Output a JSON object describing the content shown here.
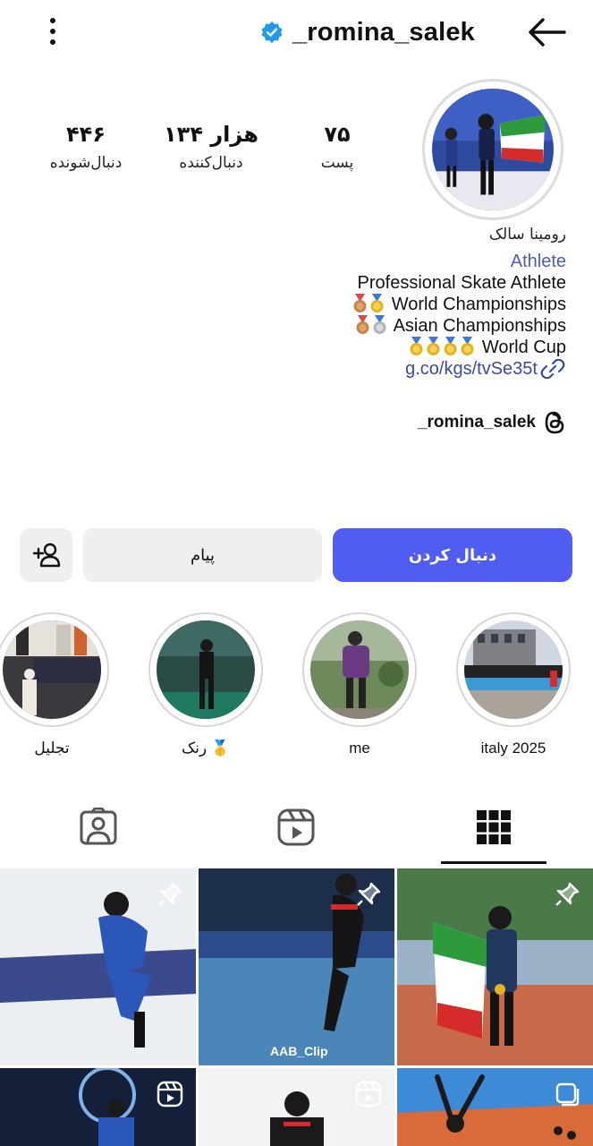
{
  "header": {
    "username": "_romina_salek"
  },
  "stats": {
    "posts": {
      "value": "۷۵",
      "label": "پست"
    },
    "followers": {
      "value": "۱۳۴ هزار",
      "label": "دنبال‌کننده"
    },
    "following": {
      "value": "۴۴۶",
      "label": "دنبال‌شونده"
    }
  },
  "bio": {
    "display_name": "رومینا سالک",
    "category": "Athlete",
    "line1": "Professional Skate Athlete",
    "line2": "World Championships",
    "line3": "Asian Championships",
    "line4": "World Cup",
    "link": "g.co/kgs/tvSe35t"
  },
  "threads": {
    "handle": "_romina_salek"
  },
  "actions": {
    "follow_label": "دنبال کردن",
    "message_label": "پیام"
  },
  "highlights": [
    {
      "label": "italy 2025"
    },
    {
      "label": "me"
    },
    {
      "label": "رنک 🥇"
    },
    {
      "label": "تجلیل"
    }
  ],
  "grid": {
    "watermark": "AAB_Clip"
  },
  "colors": {
    "follow_button": "#4f5df0",
    "link": "#3b4aa8",
    "category": "#4a5bc0",
    "verified": "#1d9bf0"
  }
}
